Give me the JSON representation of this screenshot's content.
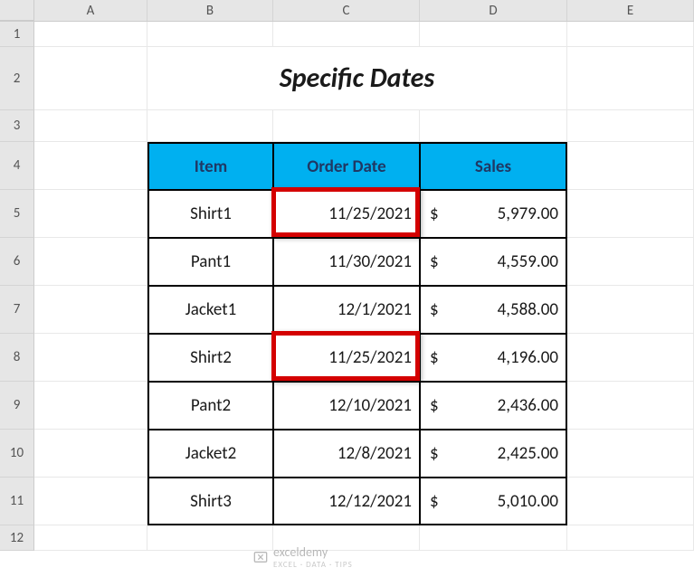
{
  "columns": [
    "A",
    "B",
    "C",
    "D",
    "E"
  ],
  "rows": [
    "1",
    "2",
    "3",
    "4",
    "5",
    "6",
    "7",
    "8",
    "9",
    "10",
    "11",
    "12"
  ],
  "rowHeights": {
    "r1": 28,
    "r2": 70,
    "r3": 35,
    "r4": 53,
    "r5": 53,
    "r6": 53,
    "r7": 53,
    "r8": 53,
    "r9": 53,
    "r10": 53,
    "r11": 53,
    "r12": 28
  },
  "title": "Specific Dates",
  "headers": {
    "item": "Item",
    "orderDate": "Order Date",
    "sales": "Sales"
  },
  "data": [
    {
      "item": "Shirt1",
      "orderDate": "11/25/2021",
      "currency": "$",
      "sales": "5,979.00"
    },
    {
      "item": "Pant1",
      "orderDate": "11/30/2021",
      "currency": "$",
      "sales": "4,559.00"
    },
    {
      "item": "Jacket1",
      "orderDate": "12/1/2021",
      "currency": "$",
      "sales": "4,588.00"
    },
    {
      "item": "Shirt2",
      "orderDate": "11/25/2021",
      "currency": "$",
      "sales": "4,196.00"
    },
    {
      "item": "Pant2",
      "orderDate": "12/10/2021",
      "currency": "$",
      "sales": "2,436.00"
    },
    {
      "item": "Jacket2",
      "orderDate": "12/8/2021",
      "currency": "$",
      "sales": "2,425.00"
    },
    {
      "item": "Shirt3",
      "orderDate": "12/12/2021",
      "currency": "$",
      "sales": "5,010.00"
    }
  ],
  "watermark": {
    "text": "exceldemy",
    "subtext": "EXCEL · DATA · TIPS"
  }
}
